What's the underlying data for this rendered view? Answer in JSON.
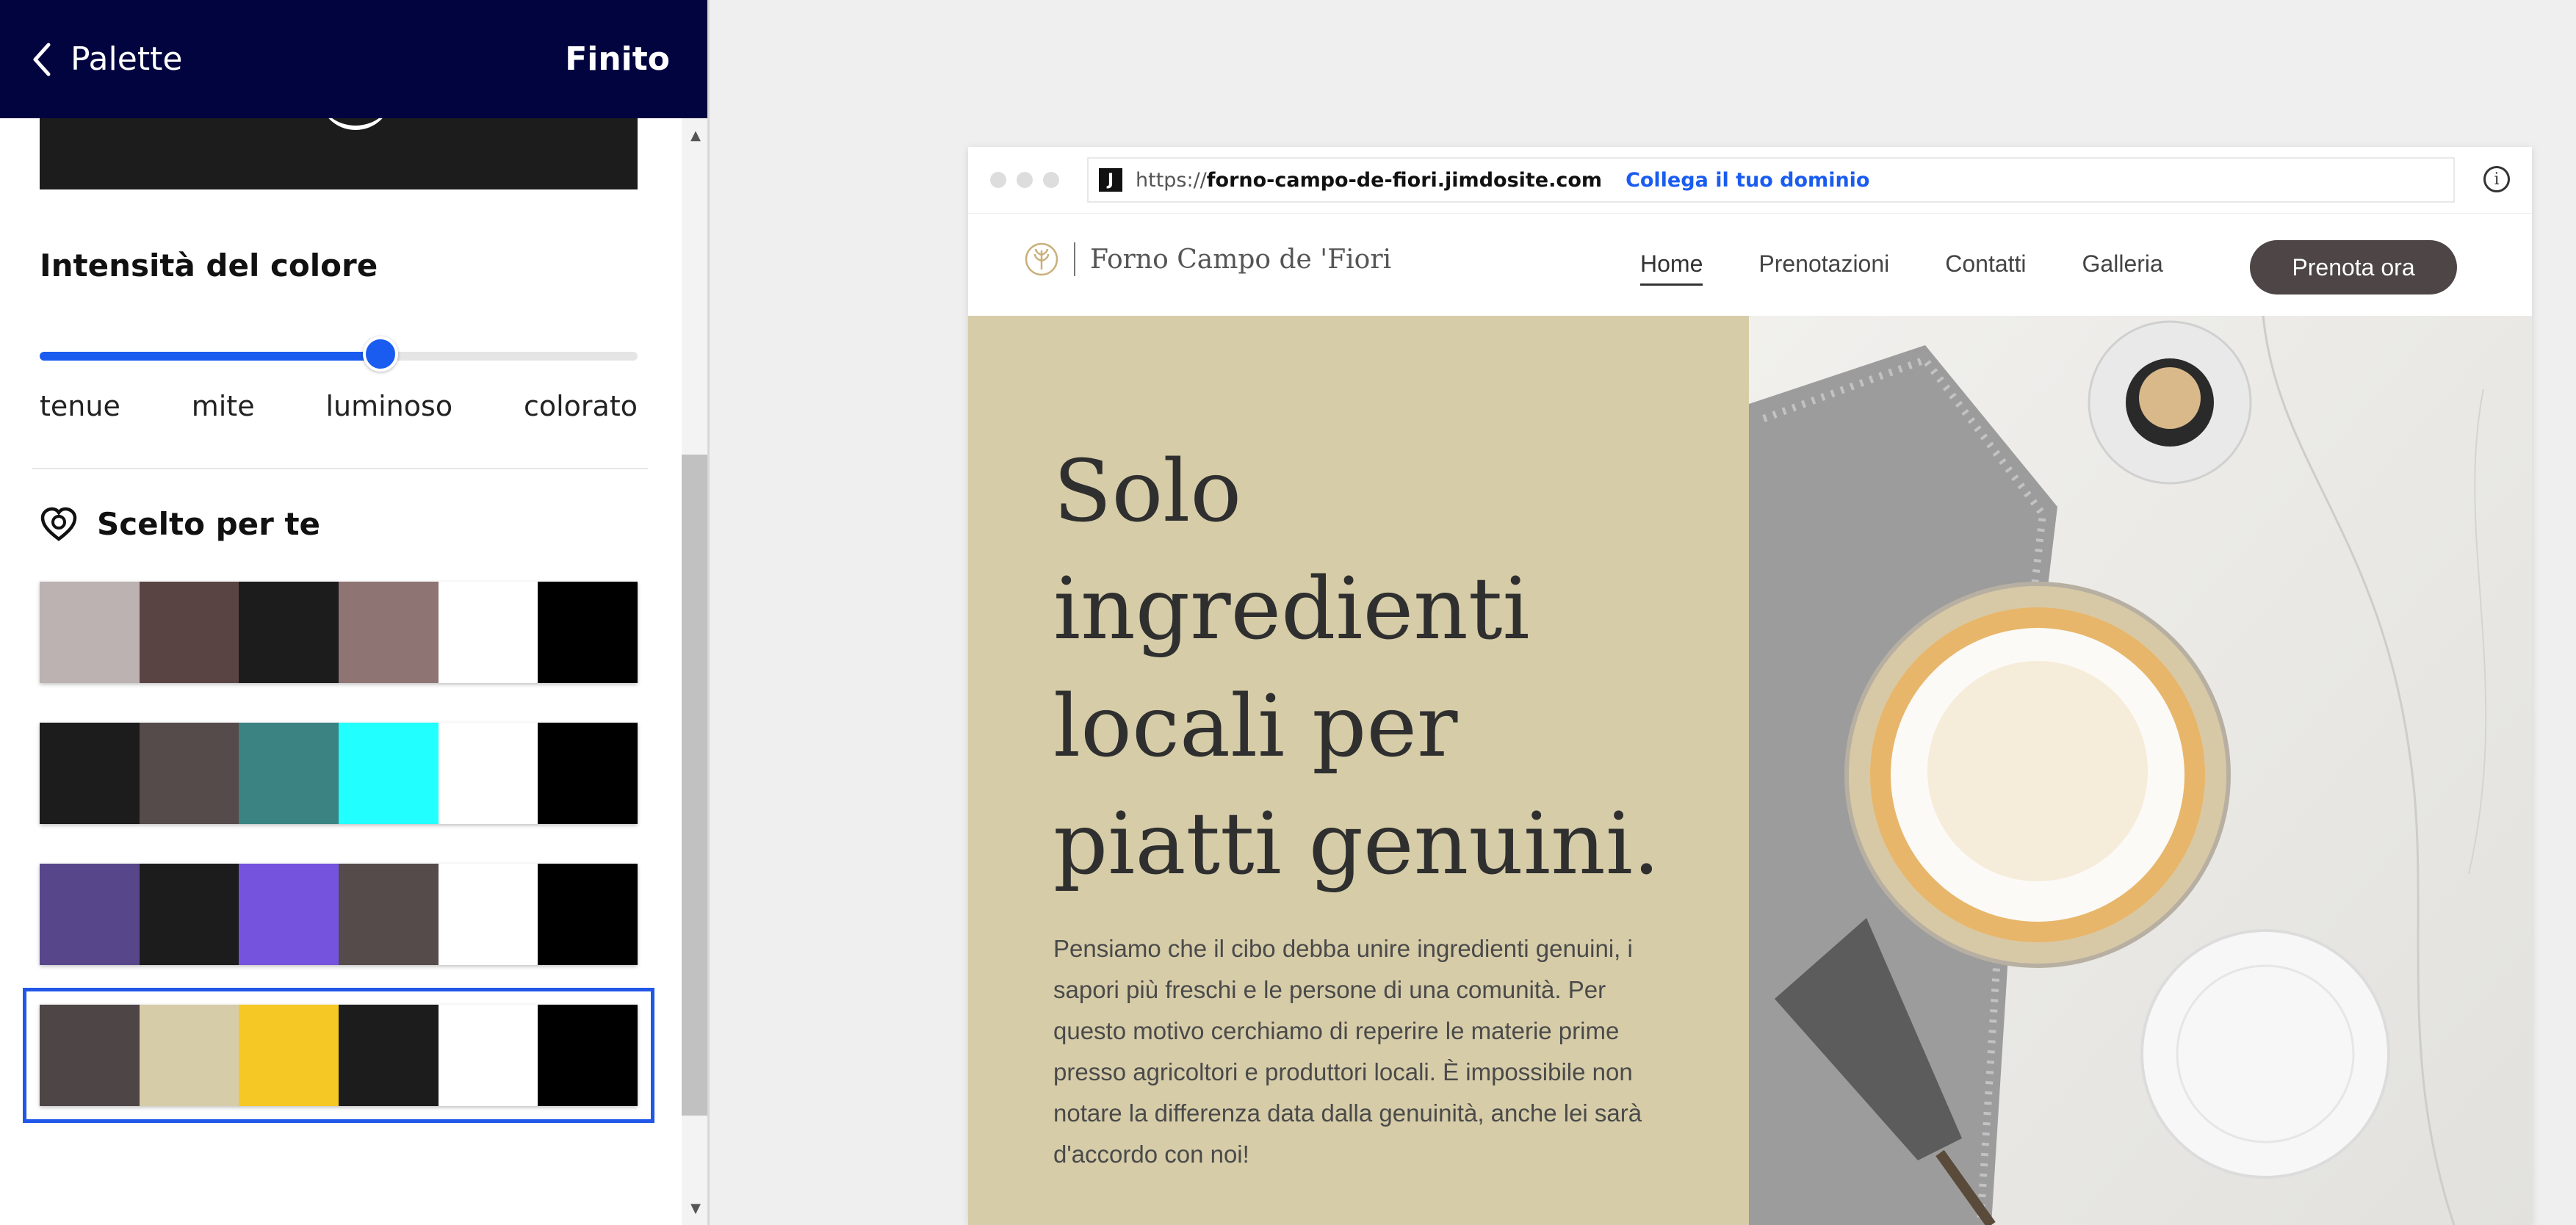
{
  "panel": {
    "title": "Palette",
    "done_label": "Finito",
    "intensity": {
      "title": "Intensità del colore",
      "labels": [
        "tenue",
        "mite",
        "luminoso",
        "colorato"
      ],
      "value_fraction": 0.57
    },
    "chosen_for_you": {
      "label": "Scelto per te",
      "icon": "heart-badge-icon"
    },
    "palettes": [
      {
        "colors": [
          "#bcb2b2",
          "#5a4443",
          "#1c1c1c",
          "#8f7474",
          "#ffffff",
          "#000000"
        ],
        "selected": false
      },
      {
        "colors": [
          "#1c1c1c",
          "#554b4b",
          "#3b8383",
          "#22ffff",
          "#ffffff",
          "#000000"
        ],
        "selected": false
      },
      {
        "colors": [
          "#57478a",
          "#1c1c1c",
          "#7553dd",
          "#554b4b",
          "#ffffff",
          "#000000"
        ],
        "selected": false
      },
      {
        "colors": [
          "#4d4546",
          "#d6cca8",
          "#f5c825",
          "#1c1c1c",
          "#ffffff",
          "#000000"
        ],
        "selected": true
      }
    ]
  },
  "browser": {
    "url_protocol": "https://",
    "url_host": "forno-campo-de-fiori.jimdosite.com",
    "connect_domain": "Collega il tuo dominio",
    "site": {
      "brand": "Forno Campo de 'Fiori",
      "nav": [
        "Home",
        "Prenotazioni",
        "Contatti",
        "Galleria"
      ],
      "active_nav": "Home",
      "cta": "Prenota ora",
      "hero_title": "Solo ingredienti locali per piatti genuini.",
      "hero_body": "Pensiamo che il cibo debba unire ingredienti genuini, i sapori più freschi e le persone di una comunità. Per questo motivo cerchiamo di reperire le materie prime presso agricoltori e produttori locali. È impossibile non notare la differenza data dalla genuinità, anche lei sarà d'accordo con noi!"
    }
  },
  "colors": {
    "header_bg": "#02043f",
    "accent": "#1a5cf0",
    "hero_bg": "#d6cca8",
    "cta_bg": "#4d4546"
  }
}
